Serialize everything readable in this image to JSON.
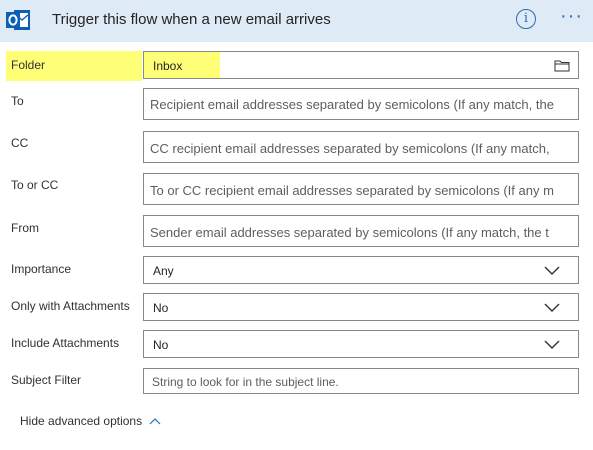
{
  "header": {
    "title": "Trigger this flow when a new email arrives",
    "logo_letter": "o",
    "info_glyph": "i",
    "more_glyph": "···",
    "accent_color": "#2b6cb5",
    "header_bg": "#dfeaf7",
    "logo_color": "#0a5fb8"
  },
  "fields": {
    "folder": {
      "label": "Folder",
      "value": "Inbox",
      "icon": "folder-icon"
    },
    "to": {
      "label": "To",
      "placeholder": "Recipient email addresses separated by semicolons (If any match, the"
    },
    "cc": {
      "label": "CC",
      "placeholder": "CC recipient email addresses separated by semicolons (If any match,"
    },
    "to_or_cc": {
      "label": "To or CC",
      "placeholder": "To or CC recipient email addresses separated by semicolons (If any m"
    },
    "from": {
      "label": "From",
      "placeholder": "Sender email addresses separated by semicolons (If any match, the t"
    },
    "importance": {
      "label": "Importance",
      "value": "Any"
    },
    "only_with_attachments": {
      "label": "Only with Attachments",
      "value": "No"
    },
    "include_attachments": {
      "label": "Include Attachments",
      "value": "No"
    },
    "subject_filter": {
      "label": "Subject Filter",
      "placeholder": "String to look for in the subject line."
    }
  },
  "advanced_toggle": {
    "label": "Hide advanced options",
    "icon": "chevron-up-icon"
  },
  "highlight_color": "#ffff77"
}
